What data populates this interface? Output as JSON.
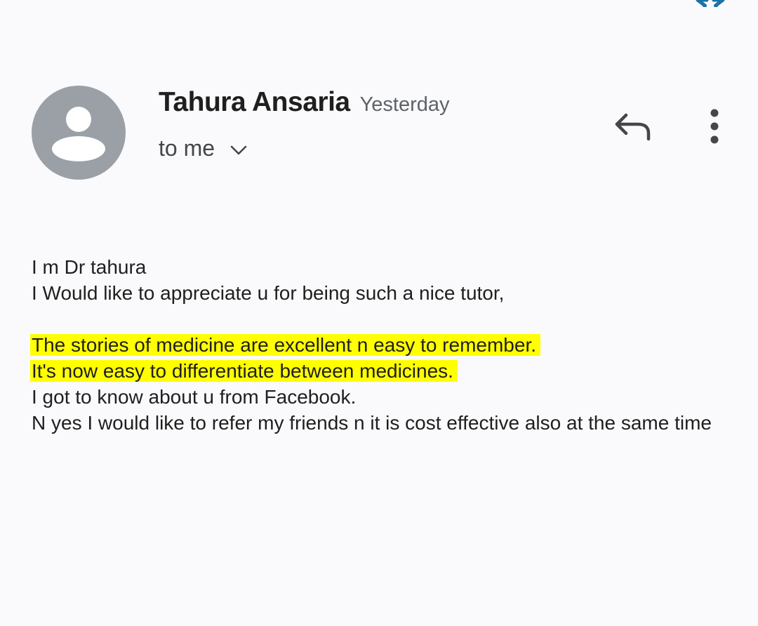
{
  "header": {
    "sender_name": "Tahura Ansaria",
    "time": "Yesterday",
    "recipient": "to me",
    "icons": {
      "avatar": "person-avatar-icon",
      "expand": "chevron-down-icon",
      "reply": "reply-icon",
      "more": "more-vert-icon",
      "star": "star-icon"
    }
  },
  "message": {
    "lines": [
      "I m Dr tahura",
      "I Would like to appreciate u for being such a nice tutor,",
      "",
      "The stories of medicine are excellent n easy to remember.",
      "It's now easy to differentiate between medicines.",
      "I got to know about u from Facebook.",
      "N yes I would like to refer my friends n it is cost effective also at the same time"
    ],
    "highlight_color": "#ffff00"
  },
  "colors": {
    "background": "#fafafc",
    "avatar": "#9aa0a6",
    "star_accent": "#1a73a8"
  }
}
